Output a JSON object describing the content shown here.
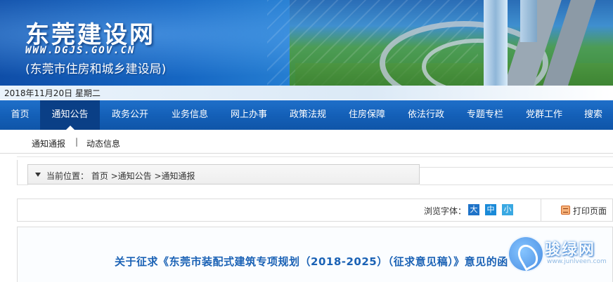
{
  "header": {
    "site_name": "东莞建设网",
    "site_url": "WWW.DGJS.GOV.CN",
    "site_sub": "(东莞市住房和城乡建设局)"
  },
  "datebar": {
    "date": "2018年11月20日  星期二"
  },
  "nav": {
    "items": [
      {
        "label": "首页"
      },
      {
        "label": "通知公告",
        "active": true
      },
      {
        "label": "政务公开"
      },
      {
        "label": "业务信息"
      },
      {
        "label": "网上办事"
      },
      {
        "label": "政策法规"
      },
      {
        "label": "住房保障"
      },
      {
        "label": "依法行政"
      },
      {
        "label": "专题专栏"
      },
      {
        "label": "党群工作"
      },
      {
        "label": "搜索"
      }
    ]
  },
  "subnav": {
    "items": [
      {
        "label": "通知通报"
      },
      {
        "label": "动态信息"
      }
    ],
    "separator": "|"
  },
  "breadcrumb": {
    "text": "当前位置： 首页 >通知公告 >通知通报"
  },
  "toolbar": {
    "font_label": "浏览字体：",
    "font_big": "大",
    "font_mid": "中",
    "font_small": "小",
    "print_label": "打印页面"
  },
  "article": {
    "title": "关于征求《东莞市装配式建筑专项规划（2018-2025）（征求意见稿）》意见的函"
  },
  "watermark": {
    "text": "骏绿网",
    "url": "www.junlveen.com"
  },
  "colors": {
    "nav_bg": "#1460b8",
    "nav_active": "#0a3f86",
    "title": "#1b62b5"
  }
}
